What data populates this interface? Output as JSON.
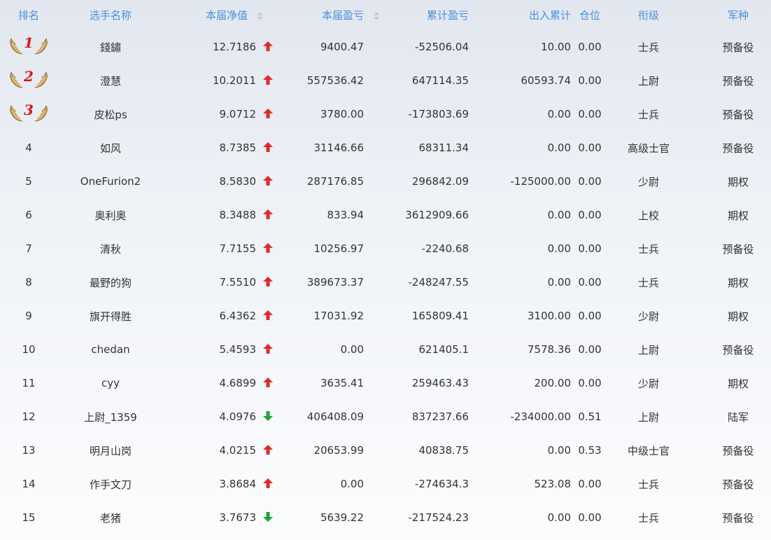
{
  "headers": {
    "rank": "排名",
    "name": "选手名称",
    "net": "本届净值",
    "pnl": "本届盈亏",
    "total": "累计盈亏",
    "flow": "出入累计",
    "position": "仓位",
    "grade": "衔级",
    "branch": "军种"
  },
  "colors": {
    "header": "#4b8fe0",
    "up": "#e02a2a",
    "down": "#23a335",
    "medal": "#d9151b"
  },
  "rows": [
    {
      "rank": "1",
      "name": "錢鏽",
      "net": "12.7186",
      "trend": "up",
      "pnl": "9400.47",
      "total": "-52506.04",
      "flow": "10.00",
      "position": "0.00",
      "grade": "士兵",
      "branch": "预备役"
    },
    {
      "rank": "2",
      "name": "澄慧",
      "net": "10.2011",
      "trend": "up",
      "pnl": "557536.42",
      "total": "647114.35",
      "flow": "60593.74",
      "position": "0.00",
      "grade": "上尉",
      "branch": "预备役"
    },
    {
      "rank": "3",
      "name": "皮松ps",
      "net": "9.0712",
      "trend": "up",
      "pnl": "3780.00",
      "total": "-173803.69",
      "flow": "0.00",
      "position": "0.00",
      "grade": "士兵",
      "branch": "预备役"
    },
    {
      "rank": "4",
      "name": "如风",
      "net": "8.7385",
      "trend": "up",
      "pnl": "31146.66",
      "total": "68311.34",
      "flow": "0.00",
      "position": "0.00",
      "grade": "高级士官",
      "branch": "预备役"
    },
    {
      "rank": "5",
      "name": "OneFurion2",
      "net": "8.5830",
      "trend": "up",
      "pnl": "287176.85",
      "total": "296842.09",
      "flow": "-125000.00",
      "position": "0.00",
      "grade": "少尉",
      "branch": "期权"
    },
    {
      "rank": "6",
      "name": "奥利奥",
      "net": "8.3488",
      "trend": "up",
      "pnl": "833.94",
      "total": "3612909.66",
      "flow": "0.00",
      "position": "0.00",
      "grade": "上校",
      "branch": "期权"
    },
    {
      "rank": "7",
      "name": "清秋",
      "net": "7.7155",
      "trend": "up",
      "pnl": "10256.97",
      "total": "-2240.68",
      "flow": "0.00",
      "position": "0.00",
      "grade": "士兵",
      "branch": "预备役"
    },
    {
      "rank": "8",
      "name": "最野的狗",
      "net": "7.5510",
      "trend": "up",
      "pnl": "389673.37",
      "total": "-248247.55",
      "flow": "0.00",
      "position": "0.00",
      "grade": "士兵",
      "branch": "期权"
    },
    {
      "rank": "9",
      "name": "旗开得胜",
      "net": "6.4362",
      "trend": "up",
      "pnl": "17031.92",
      "total": "165809.41",
      "flow": "3100.00",
      "position": "0.00",
      "grade": "少尉",
      "branch": "期权"
    },
    {
      "rank": "10",
      "name": "chedan",
      "net": "5.4593",
      "trend": "up",
      "pnl": "0.00",
      "total": "621405.1",
      "flow": "7578.36",
      "position": "0.00",
      "grade": "上尉",
      "branch": "预备役"
    },
    {
      "rank": "11",
      "name": "cyy",
      "net": "4.6899",
      "trend": "up",
      "pnl": "3635.41",
      "total": "259463.43",
      "flow": "200.00",
      "position": "0.00",
      "grade": "少尉",
      "branch": "期权"
    },
    {
      "rank": "12",
      "name": "上尉_1359",
      "net": "4.0976",
      "trend": "down",
      "pnl": "406408.09",
      "total": "837237.66",
      "flow": "-234000.00",
      "position": "0.51",
      "grade": "上尉",
      "branch": "陆军"
    },
    {
      "rank": "13",
      "name": "明月山岗",
      "net": "4.0215",
      "trend": "up",
      "pnl": "20653.99",
      "total": "40838.75",
      "flow": "0.00",
      "position": "0.53",
      "grade": "中级士官",
      "branch": "预备役"
    },
    {
      "rank": "14",
      "name": "作手文刀",
      "net": "3.8684",
      "trend": "up",
      "pnl": "0.00",
      "total": "-274634.3",
      "flow": "523.08",
      "position": "0.00",
      "grade": "士兵",
      "branch": "预备役"
    },
    {
      "rank": "15",
      "name": "老猪",
      "net": "3.7673",
      "trend": "down",
      "pnl": "5639.22",
      "total": "-217524.23",
      "flow": "0.00",
      "position": "0.00",
      "grade": "士兵",
      "branch": "预备役"
    }
  ]
}
